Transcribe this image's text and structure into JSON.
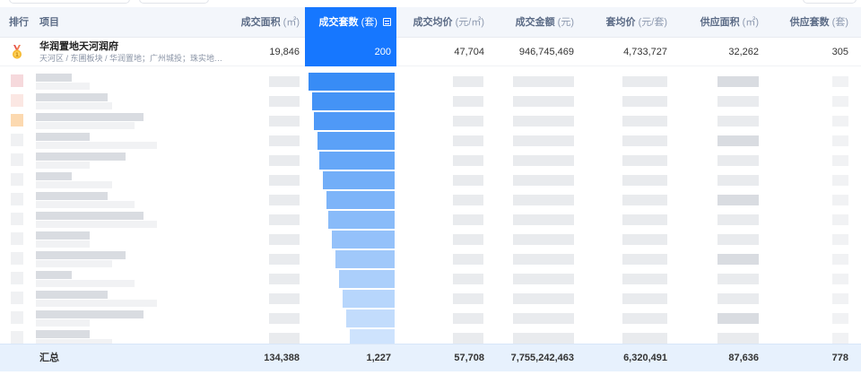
{
  "columns": {
    "rank": {
      "label": "排行",
      "unit": ""
    },
    "project": {
      "label": "项目",
      "unit": ""
    },
    "area": {
      "label": "成交面积",
      "unit": "(㎡)"
    },
    "units": {
      "label": "成交套数",
      "unit": "(套)"
    },
    "avg_price": {
      "label": "成交均价",
      "unit": "(元/㎡)"
    },
    "amount": {
      "label": "成交金额",
      "unit": "(元)"
    },
    "unit_price": {
      "label": "套均价",
      "unit": "(元/套)"
    },
    "supply_area": {
      "label": "供应面积",
      "unit": "(㎡)"
    },
    "supply_units": {
      "label": "供应套数",
      "unit": "(套)"
    }
  },
  "sort_icon": "sort-list-icon",
  "medal_icon": "gold-medal-icon",
  "rows": [
    {
      "name": "华润置地天河润府",
      "subtitle": "天河区 / 东圃板块 / 华润置地；广州城投；珠实地…",
      "area": "19,846",
      "units": "200",
      "avg_price": "47,704",
      "amount": "946,745,469",
      "unit_price": "4,733,727",
      "supply_area": "32,262",
      "supply_units": "305"
    }
  ],
  "summary": {
    "label": "汇总",
    "area": "134,388",
    "units": "1,227",
    "avg_price": "57,708",
    "amount": "7,755,242,463",
    "unit_price": "6,320,491",
    "supply_area": "87,636",
    "supply_units": "778"
  },
  "colors": {
    "accent": "#1677ff",
    "header_bg": "#f3f6fb",
    "footer_bg": "#e7f1fd"
  }
}
